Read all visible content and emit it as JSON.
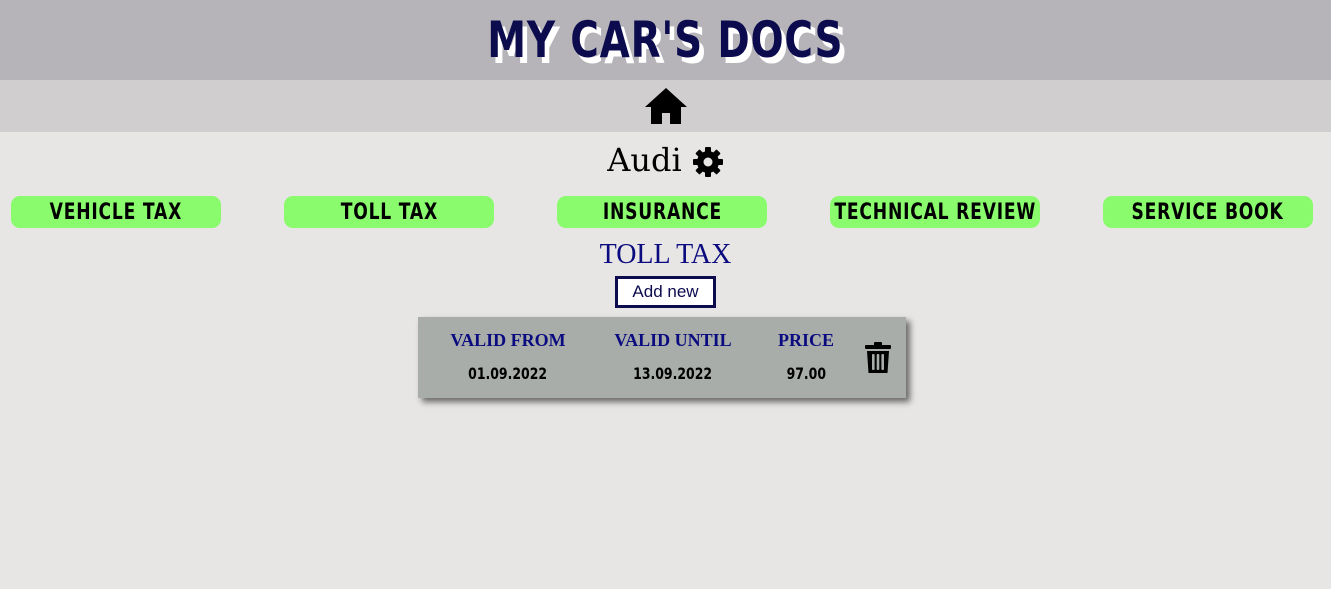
{
  "header": {
    "title": "MY CAR'S DOCS"
  },
  "nav": {
    "home_icon": "home-icon"
  },
  "car": {
    "name": "Audi",
    "settings_icon": "gear-icon"
  },
  "tabs": [
    {
      "label": "VEHICLE TAX"
    },
    {
      "label": "TOLL TAX"
    },
    {
      "label": "INSURANCE"
    },
    {
      "label": "TECHNICAL REVIEW"
    },
    {
      "label": "SERVICE BOOK"
    }
  ],
  "section": {
    "title": "TOLL TAX",
    "add_label": "Add new"
  },
  "record": {
    "headers": {
      "valid_from": "VALID FROM",
      "valid_until": "VALID UNTIL",
      "price": "PRICE"
    },
    "values": {
      "valid_from": "01.09.2022",
      "valid_until": "13.09.2022",
      "price": "97.00"
    },
    "delete_icon": "trash-icon"
  },
  "colors": {
    "header_bg": "#b6b4b9",
    "nav_bg": "#d0cecf",
    "page_bg": "#e8e6e5",
    "title_color": "#0b0b4e",
    "accent_text": "#0b0b80",
    "tab_bg": "#89fb6d",
    "card_bg": "#a9adaa"
  }
}
